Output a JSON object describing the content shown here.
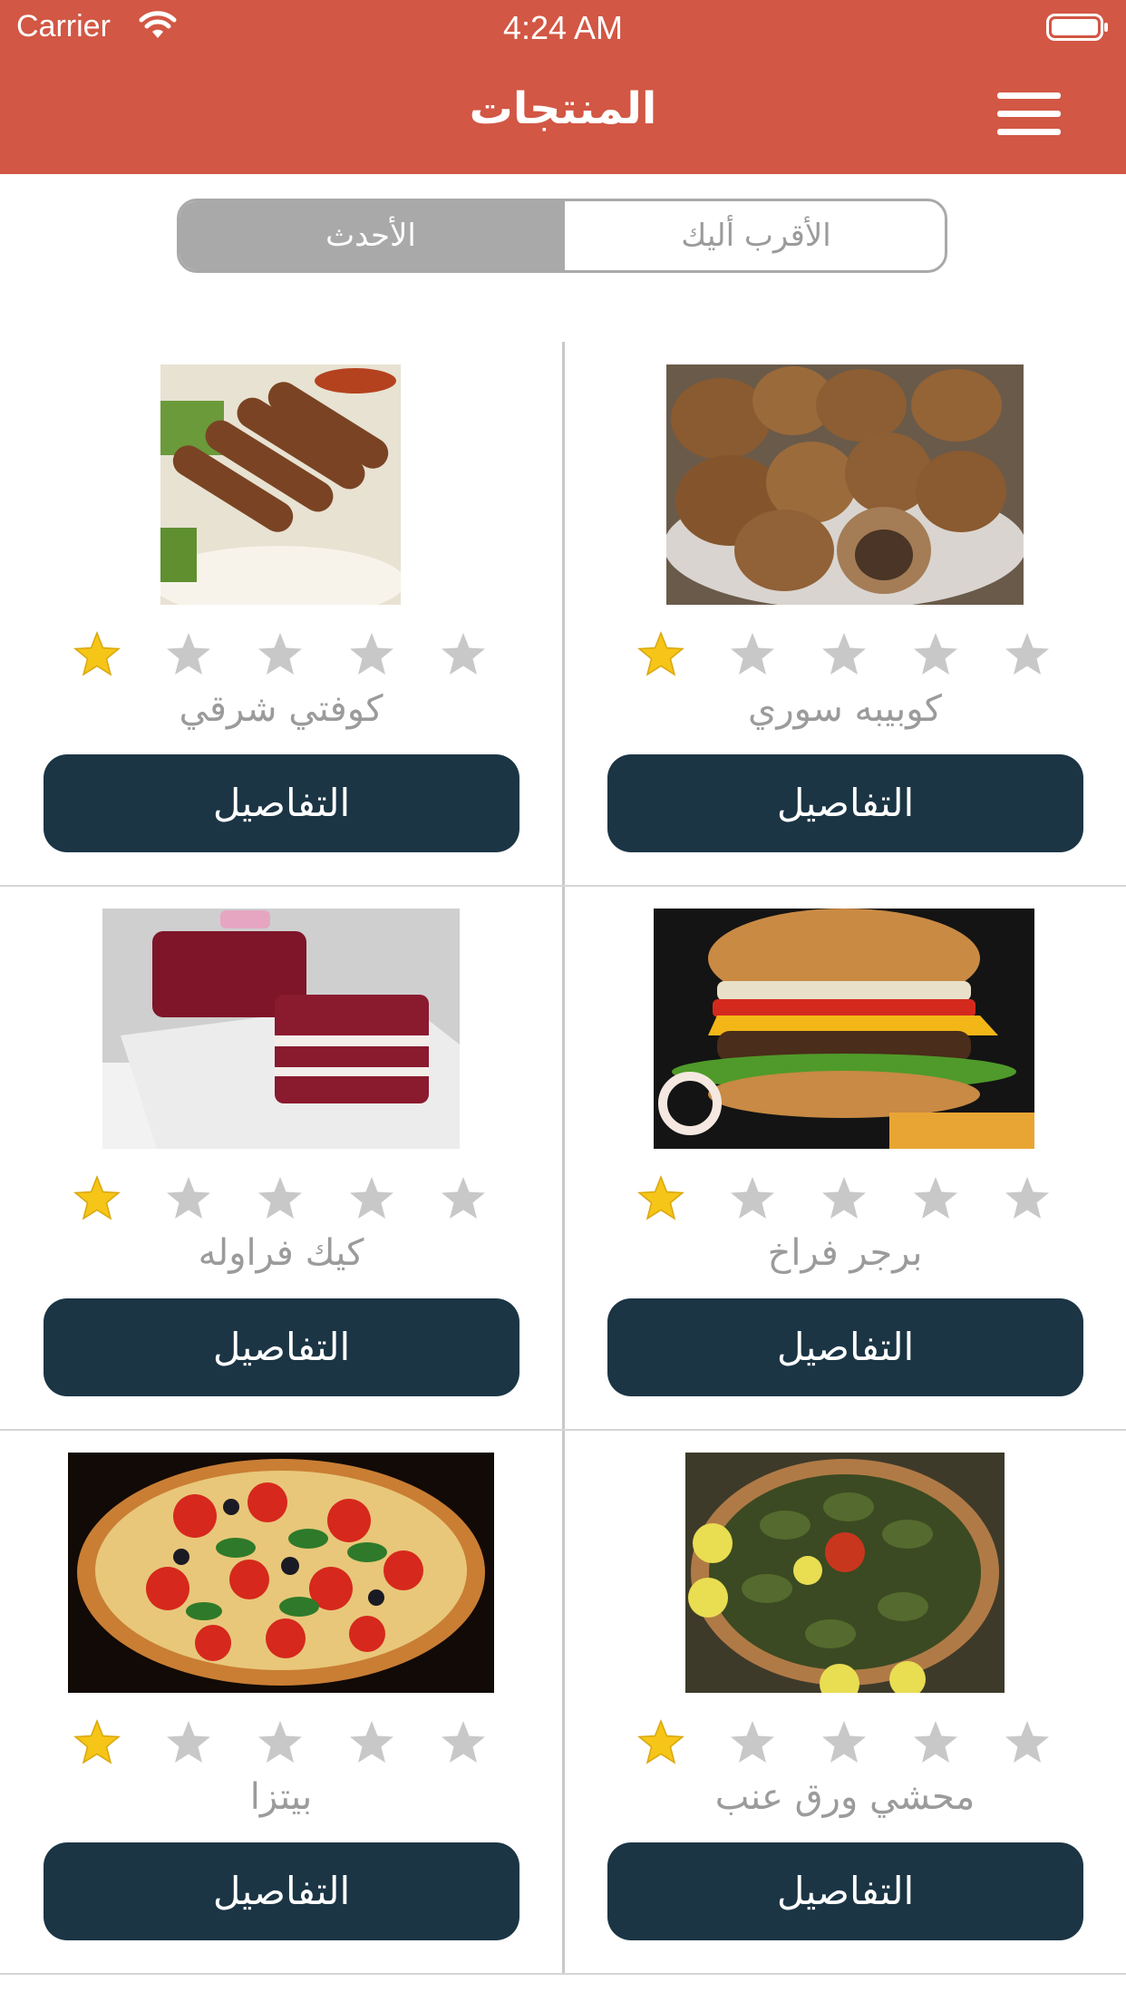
{
  "status_bar": {
    "carrier": "Carrier",
    "time": "4:24 AM"
  },
  "nav": {
    "title": "المنتجات"
  },
  "segments": {
    "newest": "الأحدث",
    "nearest": "الأقرب أليك",
    "selected": "newest"
  },
  "colors": {
    "header": "#d25744",
    "button": "#1b3545",
    "star_filled": "#f5c518",
    "star_empty": "#c8c8c8"
  },
  "products": [
    {
      "name": "كوبيبه سوري",
      "rating": 1,
      "details_label": "التفاصيل",
      "image": "kibbeh-photo"
    },
    {
      "name": "كوفتي شرقي",
      "rating": 1,
      "details_label": "التفاصيل",
      "image": "kofta-photo"
    },
    {
      "name": "برجر فراخ",
      "rating": 1,
      "details_label": "التفاصيل",
      "image": "burger-photo"
    },
    {
      "name": "كيك فراوله",
      "rating": 1,
      "details_label": "التفاصيل",
      "image": "cake-photo"
    },
    {
      "name": "محشي ورق عنب",
      "rating": 1,
      "details_label": "التفاصيل",
      "image": "stuffed-grape-leaves-photo"
    },
    {
      "name": "بيتزا",
      "rating": 1,
      "details_label": "التفاصيل",
      "image": "pizza-photo"
    }
  ]
}
